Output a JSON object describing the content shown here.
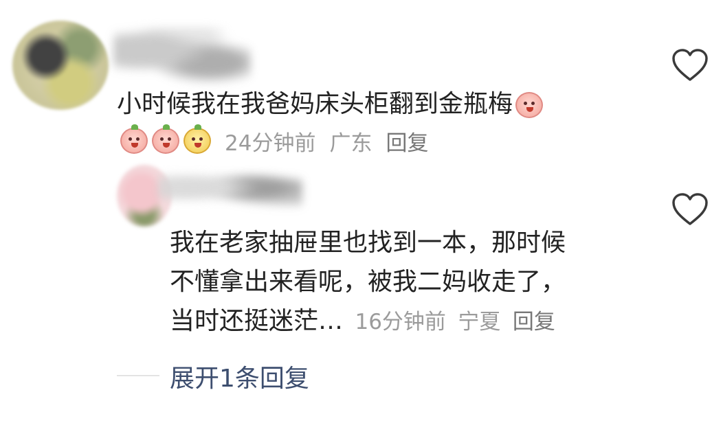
{
  "comments": [
    {
      "text": "小时候我在我爸妈床头柜翻到金瓶梅",
      "time": "24分钟前",
      "location": "广东",
      "reply_label": "回复",
      "emojis": [
        "pink-emoji",
        "pink-emoji",
        "yellow-emoji"
      ],
      "trailing_emoji": "scared-emoji"
    },
    {
      "lines": [
        "我在老家抽屉里也找到一本，那时候",
        "不懂拿出来看呢，被我二妈收走了，",
        "当时还挺迷茫…"
      ],
      "time": "16分钟前",
      "location": "宁夏",
      "reply_label": "回复"
    }
  ],
  "expand_label": "展开1条回复",
  "icons": {
    "like": "heart-icon"
  },
  "colors": {
    "text": "#222222",
    "meta": "#9b9b9b",
    "expand": "#3d4e6f"
  }
}
